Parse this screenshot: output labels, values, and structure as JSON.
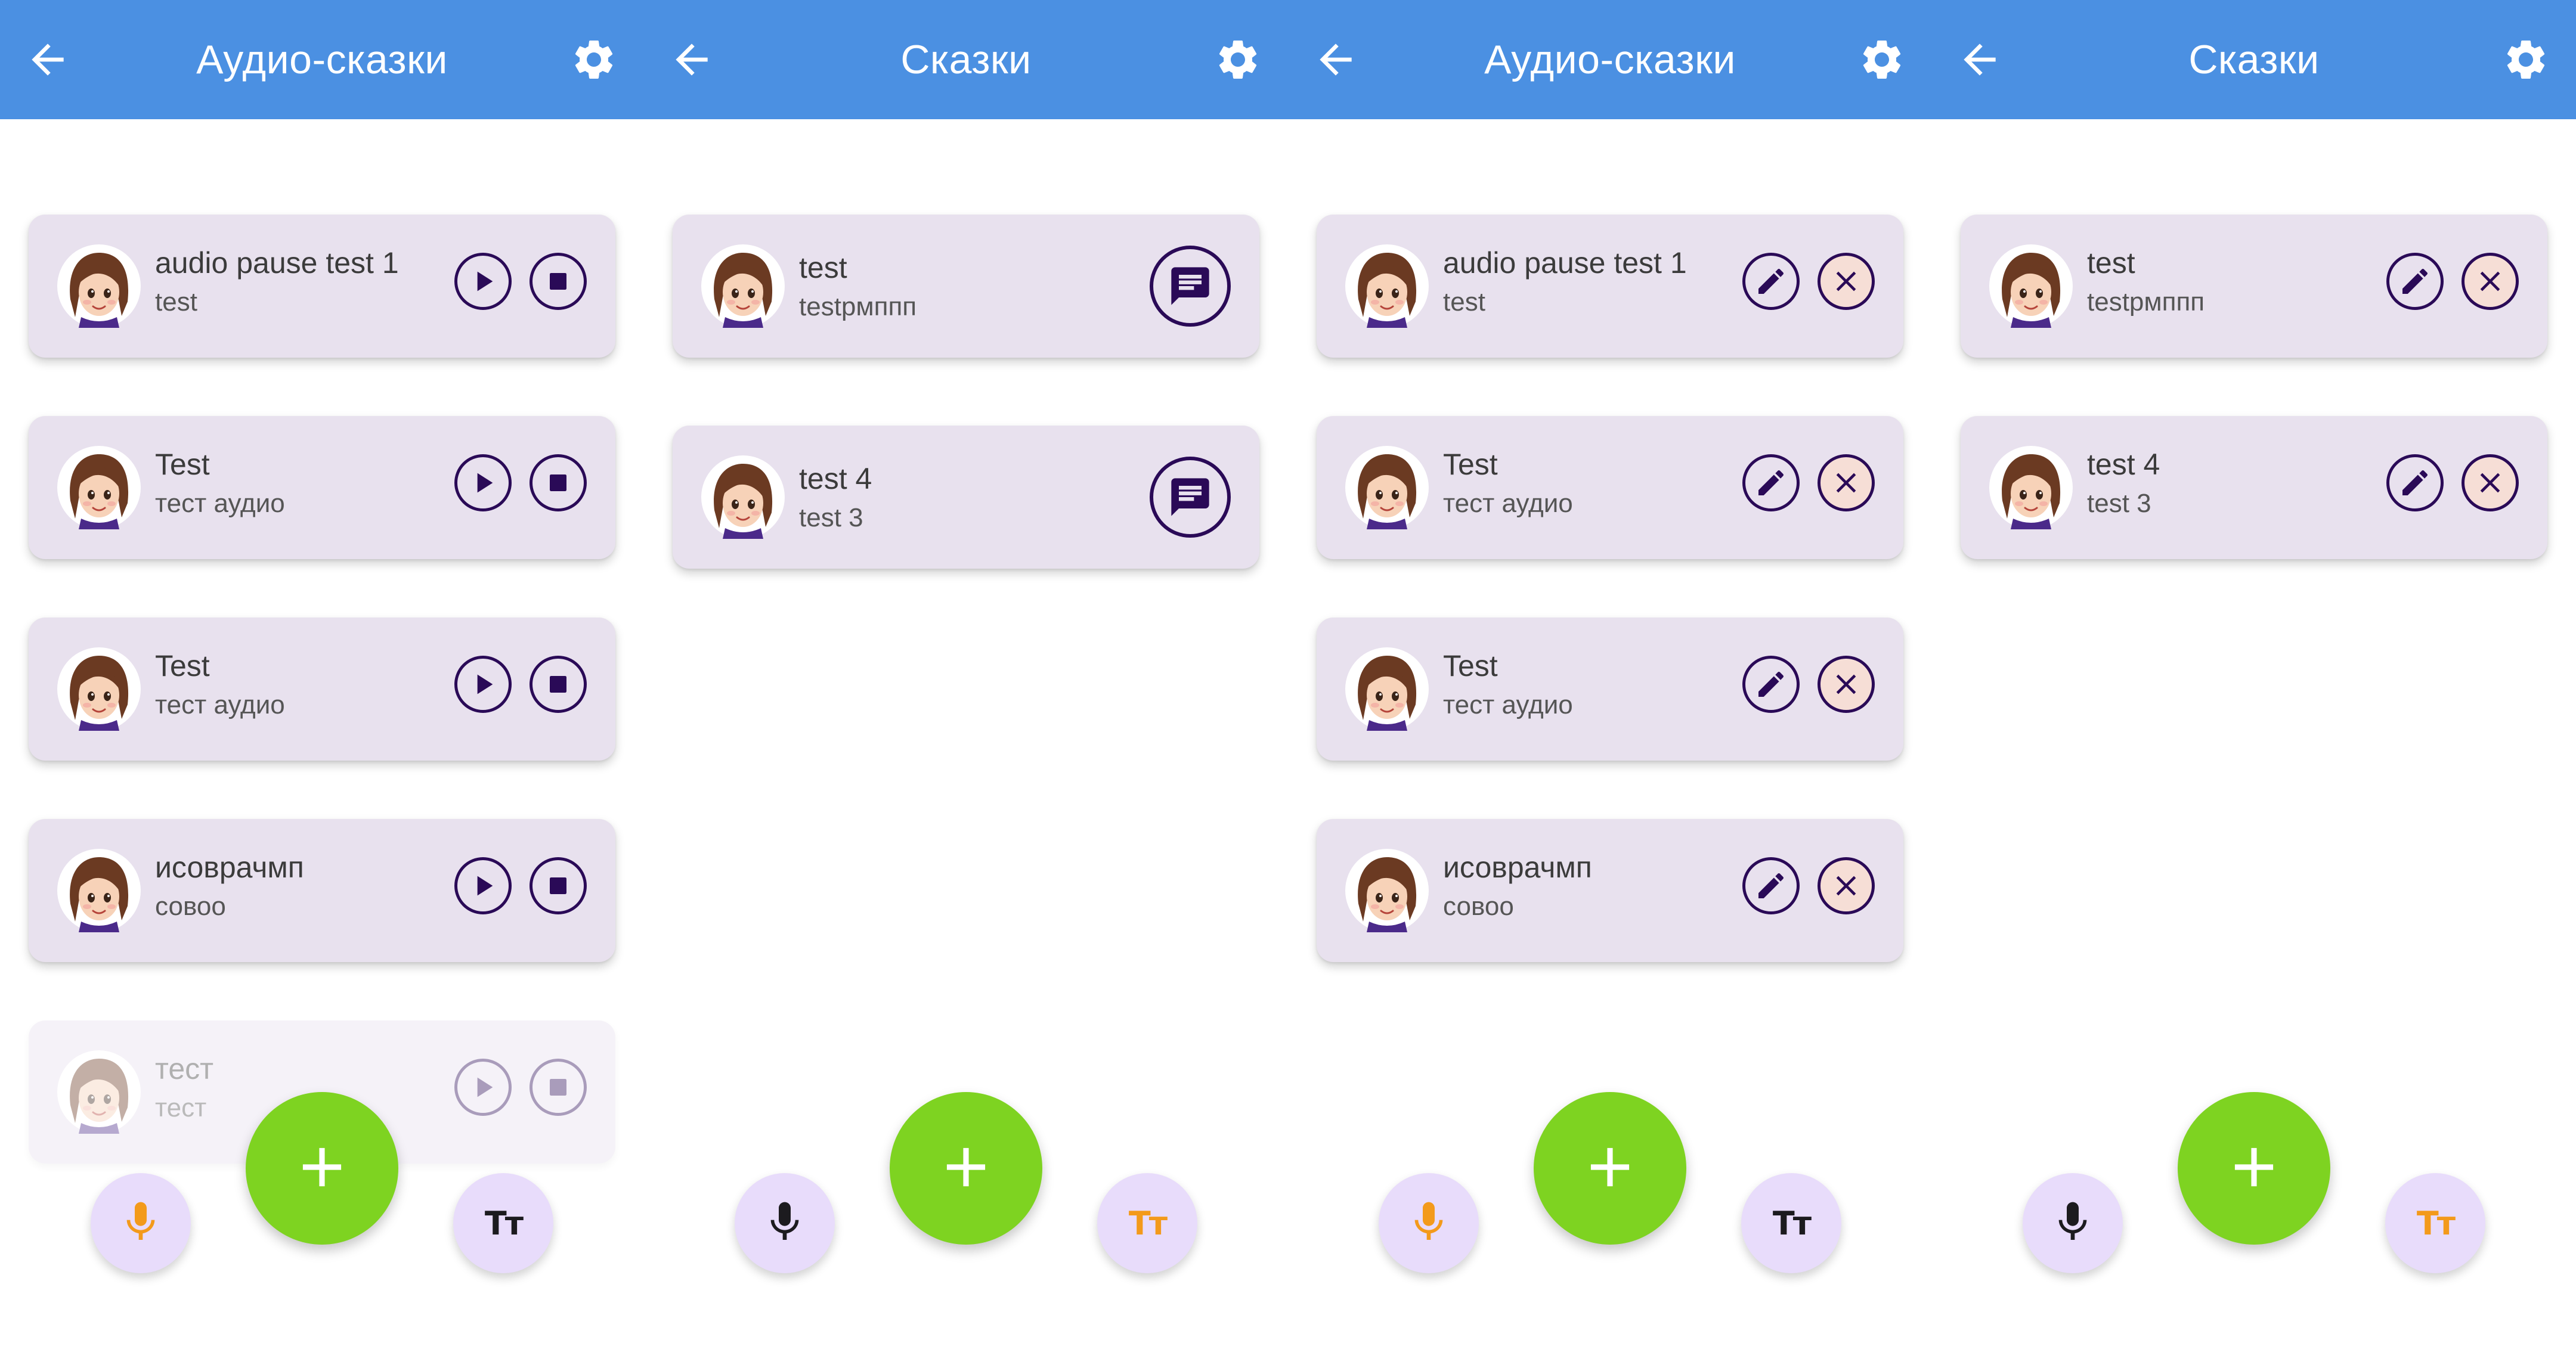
{
  "colors": {
    "appbar": "#4b90e2",
    "card": "#e8e1ee",
    "icon_dark": "#2a0a57",
    "fab_add": "#7ed321",
    "fab_small": "#e8dcfb",
    "accent_orange": "#f39a1b",
    "delete_bg": "#f6ded6"
  },
  "screens": [
    {
      "title": "Аудио-сказки",
      "mode": "play",
      "items": [
        {
          "title": "audio pause test 1",
          "subtitle": "test"
        },
        {
          "title": "Test",
          "subtitle": "тест аудио"
        },
        {
          "title": "Test",
          "subtitle": "тест аудио"
        },
        {
          "title": "исоврачмп",
          "subtitle": "совоо"
        },
        {
          "title": "тест",
          "subtitle": "тест",
          "faded": true
        }
      ],
      "mic_active": true,
      "text_active": false
    },
    {
      "title": "Сказки",
      "mode": "read",
      "items": [
        {
          "title": "test",
          "subtitle": "testрмппп"
        },
        {
          "title": "test 4",
          "subtitle": "test 3"
        }
      ],
      "mic_active": false,
      "text_active": true
    },
    {
      "title": "Аудио-сказки",
      "mode": "edit",
      "items": [
        {
          "title": "audio pause test 1",
          "subtitle": "test"
        },
        {
          "title": "Test",
          "subtitle": "тест аудио"
        },
        {
          "title": "Test",
          "subtitle": "тест аудио"
        },
        {
          "title": "исоврачмп",
          "subtitle": "совоо"
        }
      ],
      "mic_active": true,
      "text_active": false
    },
    {
      "title": "Сказки",
      "mode": "edit",
      "items": [
        {
          "title": "test",
          "subtitle": "testрмппп"
        },
        {
          "title": "test 4",
          "subtitle": "test 3"
        }
      ],
      "mic_active": false,
      "text_active": true
    }
  ],
  "icons": {
    "back": "arrow-back-icon",
    "settings": "gear-icon",
    "play": "play-icon",
    "stop": "stop-icon",
    "read": "chat-icon",
    "edit": "pencil-icon",
    "delete": "close-icon",
    "add": "plus-icon",
    "mic": "microphone-icon",
    "text": "text-size-icon",
    "avatar": "girl-avatar-icon"
  },
  "labels": {
    "text_fab": "Tт"
  }
}
